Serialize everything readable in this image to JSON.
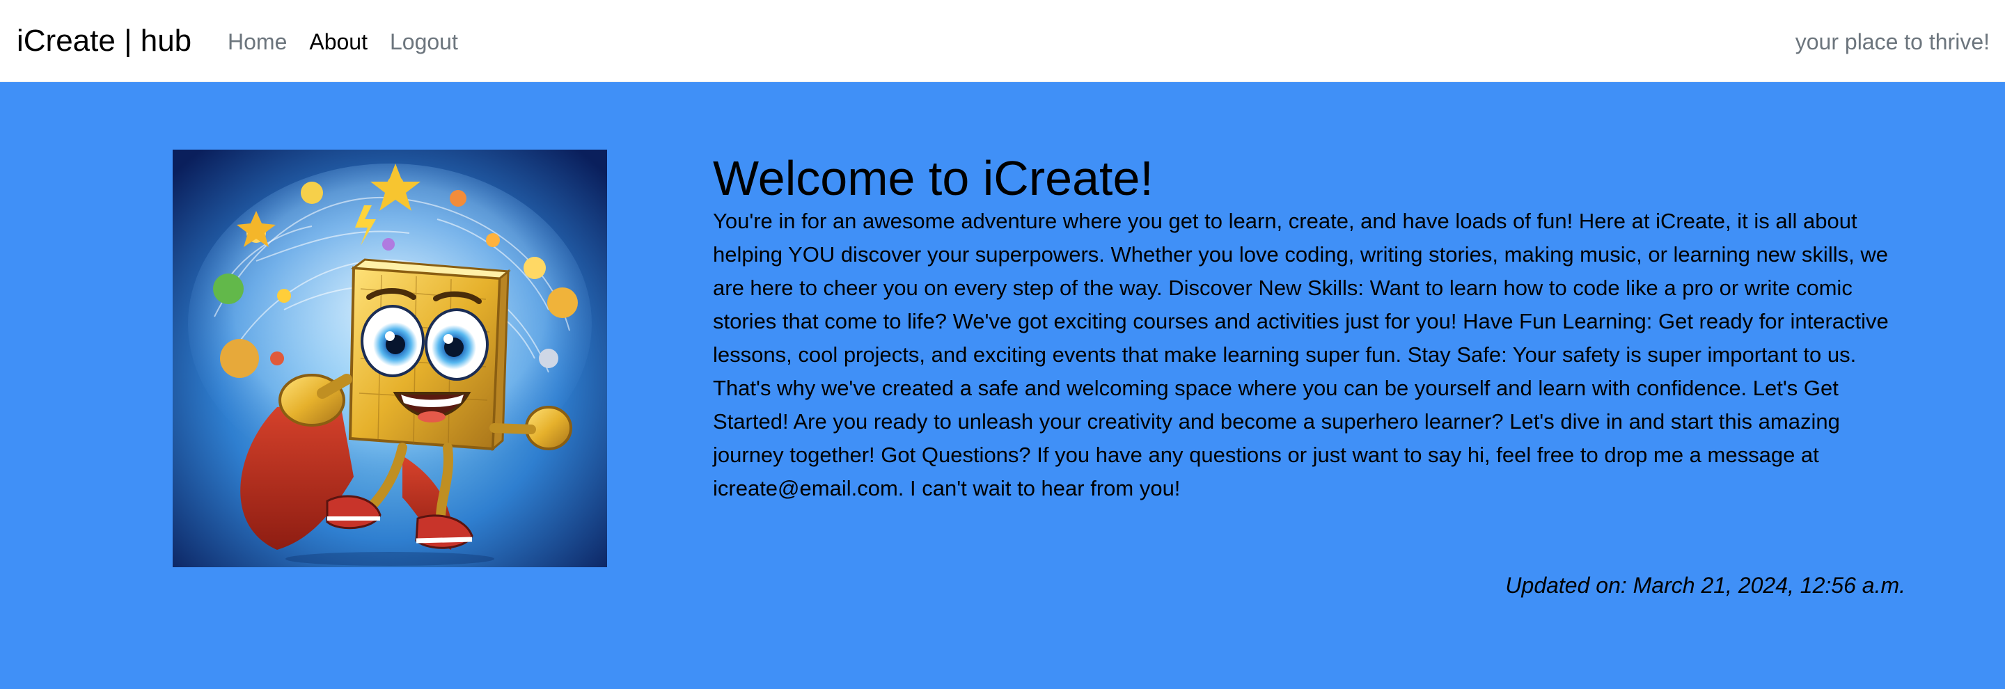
{
  "navbar": {
    "brand": "iCreate | hub",
    "links": [
      {
        "label": "Home",
        "active": false
      },
      {
        "label": "About",
        "active": true
      },
      {
        "label": "Logout",
        "active": false
      }
    ],
    "tagline": "your place to thrive!"
  },
  "main": {
    "image": {
      "icon": "superhero-block-mascot-illustration"
    },
    "title": "Welcome to iCreate!",
    "body": "You're in for an awesome adventure where you get to learn, create, and have loads of fun! Here at iCreate, it is all about helping YOU discover your superpowers. Whether you love coding, writing stories, making music, or learning new skills, we are here to cheer you on every step of the way. Discover New Skills: Want to learn how to code like a pro or write comic stories that come to life? We've got exciting courses and activities just for you! Have Fun Learning: Get ready for interactive lessons, cool projects, and exciting events that make learning super fun. Stay Safe: Your safety is super important to us. That's why we've created a safe and welcoming space where you can be yourself and learn with confidence. Let's Get Started! Are you ready to unleash your creativity and become a superhero learner? Let's dive in and start this amazing journey together! Got Questions? If you have any questions or just want to say hi, feel free to drop me a message at icreate@email.com. I can't wait to hear from you!",
    "updated": "Updated on: March 21, 2024, 12:56 a.m."
  },
  "colors": {
    "hero_background": "#4090f7",
    "navbar_background": "#ffffff",
    "muted_link": "#6c757d",
    "active_link": "#000000"
  }
}
